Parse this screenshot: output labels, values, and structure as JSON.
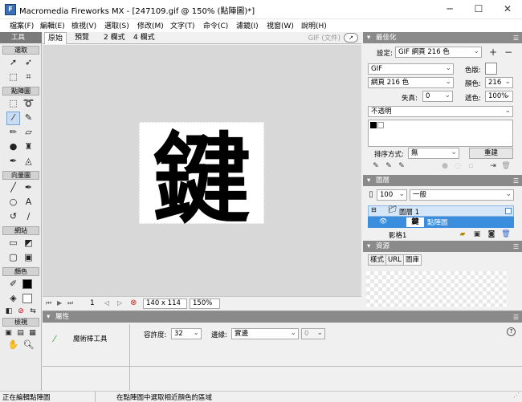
{
  "window": {
    "title": "Macromedia Fireworks MX - [247109.gif @ 150% (點陣圖)*]",
    "app_icon_text": "F",
    "minimize": "─",
    "maximize": "☐",
    "close": "✕"
  },
  "menu": [
    "檔案(F)",
    "編輯(E)",
    "檢視(V)",
    "選取(S)",
    "修改(M)",
    "文字(T)",
    "命令(C)",
    "濾鏡(I)",
    "視窗(W)",
    "說明(H)"
  ],
  "tools": {
    "title": "工具",
    "sections": {
      "select": "選取",
      "bitmap": "點陣圖",
      "vector": "向量圖",
      "web": "網站",
      "colors": "顏色",
      "view": "檢視"
    }
  },
  "document": {
    "tabs": [
      "原始",
      "預覽",
      "2 欄式",
      "4 欄式"
    ],
    "active_tab": "原始",
    "file_type": "GIF (文件)",
    "image_text": "鍵",
    "page_number": "1",
    "dimensions": "140 x 114",
    "zoom": "150%"
  },
  "optimize": {
    "title": "最佳化",
    "settings_label": "設定:",
    "settings_value": "GIF 網頁 216 色",
    "format": "GIF",
    "palette": "網頁 216 色",
    "matte_label": "色版:",
    "colors_label": "顏色:",
    "colors_value": "216",
    "loss_label": "失真:",
    "loss_value": "0",
    "dither_label": "遞色:",
    "dither_value": "100%",
    "transparency": "不透明",
    "sort_label": "排序方式:",
    "sort_value": "無",
    "rebuild": "重建"
  },
  "layers": {
    "title": "圖層",
    "opacity": "100",
    "blend": "一般",
    "layer1": "圖層 1",
    "bitmap_object": "點陣圖",
    "frame_label": "影格1"
  },
  "assets": {
    "title": "資源",
    "tabs": [
      "樣式",
      "URL",
      "圖庫"
    ],
    "active_tab": "圖庫"
  },
  "properties": {
    "title": "屬性",
    "tool_name": "魔術棒工具",
    "tolerance_label": "容許度:",
    "tolerance_value": "32",
    "edge_label": "邊緣:",
    "edge_value": "實邊",
    "feather_value": "0"
  },
  "status": {
    "left": "正在編輯點陣圖",
    "center": "在點陣圖中選取相近顏色的區域"
  },
  "colors": {
    "selection_blue": "#3b8ede",
    "panel_header": "#8a8a8a",
    "canvas_bg": "#d8d8d8"
  }
}
